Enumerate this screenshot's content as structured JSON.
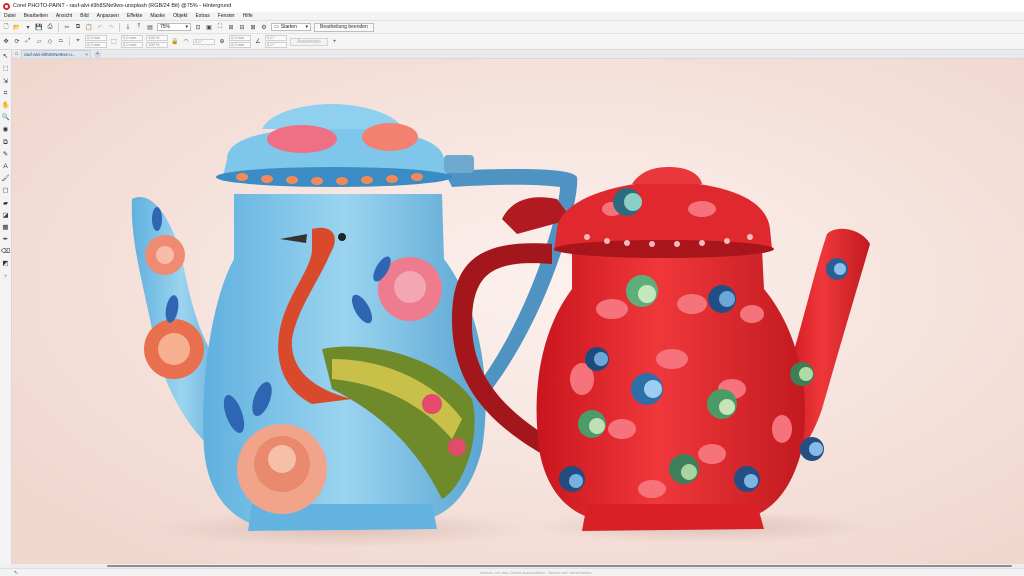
{
  "window": {
    "title": "Corel PHOTO-PAINT - rauf-alvi-ii9h8SNe9ws-unsplash (RGB/24 Bit) @75% - Hintergrund",
    "icon": "corel-photopaint-icon"
  },
  "menubar": {
    "items": [
      "Datei",
      "Bearbeiten",
      "Ansicht",
      "Bild",
      "Anpassen",
      "Effekte",
      "Maske",
      "Objekt",
      "Extras",
      "Fenster",
      "Hilfe"
    ]
  },
  "toolbar": {
    "zoom_value": "75%",
    "workspace_value": "Starten",
    "end_edit_label": "Bearbeitung beenden"
  },
  "property_bar": {
    "fields_a": [
      "0,0 mm",
      "0,0 mm"
    ],
    "fields_b": [
      "0,0 mm",
      "0,0 mm"
    ],
    "fields_c": [
      "100 %",
      "100 %"
    ],
    "angle": "0,0 °",
    "fields_d": [
      "0,0 mm",
      "0,0 mm"
    ],
    "fields_e": [
      "0,0 °",
      "0,0 °"
    ],
    "disabled_button": "Anwenden"
  },
  "document_tab": {
    "label": "rauf-alvi-ii9h8SNe9ws-u...",
    "close": "×"
  },
  "status": {
    "hint": "Klicken, um das Objekt auszuwählen, Ziehen zum Verschieben"
  },
  "colors": {
    "accent": "#d9262b",
    "canvas_bg": "#f7e4dd",
    "blue_pot": "#7fc3e6",
    "red_pot": "#e3282d"
  }
}
